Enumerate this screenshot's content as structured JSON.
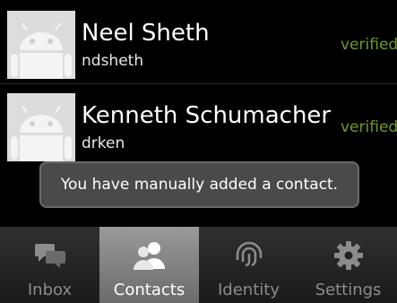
{
  "contacts": [
    {
      "name": "Neel Sheth",
      "username": "ndsheth",
      "status": "verified"
    },
    {
      "name": "Kenneth Schumacher",
      "username": "drken",
      "status": "verified"
    }
  ],
  "toast": {
    "message": "You have manually added a contact."
  },
  "tabs": [
    {
      "label": "Inbox",
      "icon": "chat-bubbles-icon",
      "active": false
    },
    {
      "label": "Contacts",
      "icon": "people-icon",
      "active": true
    },
    {
      "label": "Identity",
      "icon": "fingerprint-icon",
      "active": false
    },
    {
      "label": "Settings",
      "icon": "gear-icon",
      "active": false
    }
  ],
  "colors": {
    "verified": "#6f9a2a",
    "background": "#000000",
    "toast": "#4a4a4a"
  }
}
